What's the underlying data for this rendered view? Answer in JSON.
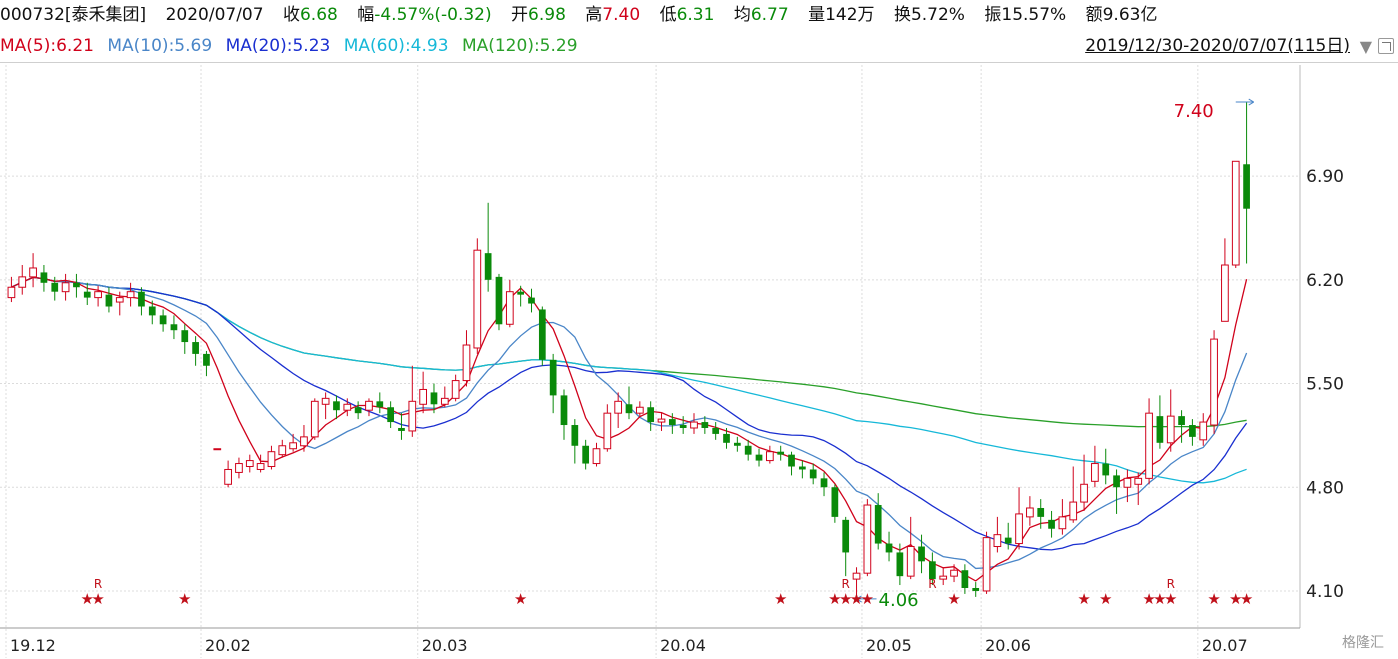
{
  "header": {
    "code": "000732[泰禾集团]",
    "date": "2020/07/07",
    "close_label": "收",
    "close": "6.68",
    "change_label": "幅",
    "change": "-4.57%(-0.32)",
    "open_label": "开",
    "open": "6.98",
    "high_label": "高",
    "high": "7.40",
    "low_label": "低",
    "low": "6.31",
    "avg_label": "均",
    "avg": "6.77",
    "vol_label": "量",
    "vol": "142万",
    "turnover_label": "换",
    "turnover": "5.72%",
    "amplitude_label": "振",
    "amplitude": "15.57%",
    "amount_label": "额",
    "amount": "9.63亿"
  },
  "ma_bar": {
    "ma5": "MA(5):6.21",
    "ma10": "MA(10):5.69",
    "ma20": "MA(20):5.23",
    "ma60": "MA(60):4.93",
    "ma120": "MA(120):5.29",
    "range": "2019/12/30-2020/07/07(115日)"
  },
  "colors": {
    "up": "#d0021b",
    "down": "#0a8a0a",
    "ma5": "#d0021b",
    "ma10": "#4a86c8",
    "ma20": "#1a2fd0",
    "ma60": "#16b8d8",
    "ma120": "#2aa02a"
  },
  "watermark": "格隆汇",
  "chart_data": {
    "type": "candlestick",
    "y_ticks": [
      "6.90",
      "6.20",
      "5.50",
      "4.80",
      "4.10"
    ],
    "ylim": [
      3.85,
      7.65
    ],
    "x_ticks": [
      {
        "label": "19.12",
        "index": 0
      },
      {
        "label": "20.02",
        "index": 18
      },
      {
        "label": "20.03",
        "index": 38
      },
      {
        "label": "20.04",
        "index": 60
      },
      {
        "label": "20.05",
        "index": 79
      },
      {
        "label": "20.06",
        "index": 90
      },
      {
        "label": "20.07",
        "index": 110
      }
    ],
    "annotations": {
      "high": {
        "label": "7.40",
        "index": 113,
        "value": 7.4
      },
      "low": {
        "label": "4.06",
        "index": 78,
        "value": 4.06
      }
    },
    "star_indices": [
      7,
      8,
      16,
      47,
      71,
      76,
      77,
      78,
      79,
      87,
      99,
      101,
      105,
      106,
      107,
      111,
      113,
      114
    ],
    "r_indices": [
      8,
      77,
      85,
      107
    ],
    "candles": [
      [
        6.08,
        6.15,
        6.22,
        6.05
      ],
      [
        6.15,
        6.22,
        6.3,
        6.1
      ],
      [
        6.22,
        6.28,
        6.38,
        6.15
      ],
      [
        6.25,
        6.18,
        6.3,
        6.12
      ],
      [
        6.18,
        6.12,
        6.22,
        6.06
      ],
      [
        6.12,
        6.18,
        6.24,
        6.06
      ],
      [
        6.18,
        6.15,
        6.24,
        6.08
      ],
      [
        6.12,
        6.08,
        6.18,
        6.03
      ],
      [
        6.08,
        6.12,
        6.16,
        6.02
      ],
      [
        6.1,
        6.02,
        6.15,
        5.98
      ],
      [
        6.05,
        6.08,
        6.12,
        5.96
      ],
      [
        6.08,
        6.12,
        6.18,
        6.02
      ],
      [
        6.12,
        6.02,
        6.15,
        5.96
      ],
      [
        6.02,
        5.96,
        6.06,
        5.9
      ],
      [
        5.96,
        5.9,
        6.0,
        5.85
      ],
      [
        5.9,
        5.86,
        5.96,
        5.8
      ],
      [
        5.86,
        5.78,
        5.9,
        5.7
      ],
      [
        5.78,
        5.7,
        5.82,
        5.62
      ],
      [
        5.7,
        5.62,
        5.72,
        5.55
      ],
      [
        5.06,
        5.06,
        5.06,
        5.06
      ],
      [
        4.82,
        4.92,
        4.98,
        4.8
      ],
      [
        4.9,
        4.96,
        5.0,
        4.86
      ],
      [
        4.94,
        4.98,
        5.02,
        4.9
      ],
      [
        4.92,
        4.96,
        5.02,
        4.9
      ],
      [
        4.94,
        5.04,
        5.08,
        4.92
      ],
      [
        5.02,
        5.08,
        5.12,
        5.0
      ],
      [
        5.06,
        5.1,
        5.16,
        5.04
      ],
      [
        5.08,
        5.14,
        5.22,
        5.04
      ],
      [
        5.14,
        5.38,
        5.4,
        5.12
      ],
      [
        5.36,
        5.4,
        5.44,
        5.26
      ],
      [
        5.38,
        5.32,
        5.42,
        5.26
      ],
      [
        5.32,
        5.36,
        5.4,
        5.28
      ],
      [
        5.34,
        5.3,
        5.38,
        5.26
      ],
      [
        5.32,
        5.38,
        5.4,
        5.28
      ],
      [
        5.38,
        5.34,
        5.44,
        5.3
      ],
      [
        5.34,
        5.24,
        5.38,
        5.2
      ],
      [
        5.2,
        5.18,
        5.3,
        5.12
      ],
      [
        5.18,
        5.38,
        5.62,
        5.14
      ],
      [
        5.36,
        5.46,
        5.58,
        5.3
      ],
      [
        5.44,
        5.36,
        5.5,
        5.3
      ],
      [
        5.36,
        5.4,
        5.48,
        5.34
      ],
      [
        5.4,
        5.52,
        5.56,
        5.38
      ],
      [
        5.52,
        5.76,
        5.86,
        5.48
      ],
      [
        5.74,
        6.4,
        6.48,
        5.7
      ],
      [
        6.38,
        6.2,
        6.72,
        6.12
      ],
      [
        6.22,
        5.9,
        6.24,
        5.86
      ],
      [
        5.9,
        6.12,
        6.2,
        5.88
      ],
      [
        6.12,
        6.1,
        6.16,
        6.02
      ],
      [
        6.08,
        6.04,
        6.14,
        5.98
      ],
      [
        6.0,
        5.66,
        6.02,
        5.62
      ],
      [
        5.66,
        5.42,
        5.7,
        5.3
      ],
      [
        5.42,
        5.22,
        5.46,
        5.12
      ],
      [
        5.22,
        5.08,
        5.26,
        4.96
      ],
      [
        5.08,
        4.96,
        5.12,
        4.92
      ],
      [
        4.96,
        5.06,
        5.1,
        4.94
      ],
      [
        5.06,
        5.3,
        5.36,
        5.04
      ],
      [
        5.3,
        5.38,
        5.44,
        5.2
      ],
      [
        5.36,
        5.3,
        5.48,
        5.26
      ],
      [
        5.3,
        5.34,
        5.38,
        5.28
      ],
      [
        5.34,
        5.24,
        5.38,
        5.18
      ],
      [
        5.24,
        5.26,
        5.3,
        5.18
      ],
      [
        5.26,
        5.22,
        5.3,
        5.16
      ],
      [
        5.22,
        5.2,
        5.28,
        5.16
      ],
      [
        5.2,
        5.24,
        5.3,
        5.16
      ],
      [
        5.24,
        5.2,
        5.28,
        5.16
      ],
      [
        5.2,
        5.16,
        5.24,
        5.12
      ],
      [
        5.16,
        5.1,
        5.2,
        5.06
      ],
      [
        5.1,
        5.08,
        5.14,
        5.04
      ],
      [
        5.08,
        5.02,
        5.12,
        4.98
      ],
      [
        5.02,
        4.98,
        5.06,
        4.94
      ],
      [
        4.98,
        5.04,
        5.08,
        4.96
      ],
      [
        5.04,
        5.02,
        5.08,
        4.98
      ],
      [
        5.02,
        4.94,
        5.04,
        4.88
      ],
      [
        4.94,
        4.92,
        4.98,
        4.86
      ],
      [
        4.92,
        4.86,
        4.96,
        4.82
      ],
      [
        4.86,
        4.8,
        4.9,
        4.74
      ],
      [
        4.8,
        4.6,
        4.82,
        4.56
      ],
      [
        4.58,
        4.36,
        4.6,
        4.2
      ],
      [
        4.18,
        4.22,
        4.26,
        4.06
      ],
      [
        4.22,
        4.68,
        4.72,
        4.2
      ],
      [
        4.68,
        4.42,
        4.76,
        4.38
      ],
      [
        4.42,
        4.36,
        4.5,
        4.3
      ],
      [
        4.36,
        4.2,
        4.42,
        4.14
      ],
      [
        4.2,
        4.4,
        4.6,
        4.18
      ],
      [
        4.4,
        4.3,
        4.48,
        4.22
      ],
      [
        4.3,
        4.18,
        4.36,
        4.14
      ],
      [
        4.18,
        4.2,
        4.26,
        4.14
      ],
      [
        4.2,
        4.24,
        4.28,
        4.16
      ],
      [
        4.24,
        4.12,
        4.28,
        4.08
      ],
      [
        4.12,
        4.1,
        4.16,
        4.06
      ],
      [
        4.1,
        4.46,
        4.5,
        4.08
      ],
      [
        4.4,
        4.48,
        4.6,
        4.36
      ],
      [
        4.46,
        4.42,
        4.56,
        4.38
      ],
      [
        4.42,
        4.62,
        4.8,
        4.38
      ],
      [
        4.6,
        4.66,
        4.74,
        4.54
      ],
      [
        4.66,
        4.6,
        4.72,
        4.52
      ],
      [
        4.58,
        4.52,
        4.64,
        4.46
      ],
      [
        4.52,
        4.6,
        4.72,
        4.48
      ],
      [
        4.58,
        4.7,
        4.94,
        4.56
      ],
      [
        4.7,
        4.82,
        5.02,
        4.64
      ],
      [
        4.84,
        4.96,
        5.08,
        4.8
      ],
      [
        4.96,
        4.88,
        5.06,
        4.82
      ],
      [
        4.88,
        4.8,
        4.92,
        4.62
      ],
      [
        4.8,
        4.86,
        4.92,
        4.7
      ],
      [
        4.82,
        4.86,
        4.9,
        4.68
      ],
      [
        4.86,
        5.3,
        5.4,
        4.82
      ],
      [
        5.28,
        5.1,
        5.42,
        5.06
      ],
      [
        5.1,
        5.28,
        5.46,
        5.04
      ],
      [
        5.28,
        5.22,
        5.32,
        5.1
      ],
      [
        5.22,
        5.14,
        5.26,
        5.08
      ],
      [
        5.12,
        5.24,
        5.3,
        5.08
      ],
      [
        5.22,
        5.8,
        5.86,
        5.16
      ],
      [
        5.92,
        6.3,
        6.48,
        5.92
      ],
      [
        6.3,
        7.0,
        7.0,
        6.28
      ],
      [
        6.98,
        6.68,
        7.4,
        6.31
      ]
    ]
  }
}
